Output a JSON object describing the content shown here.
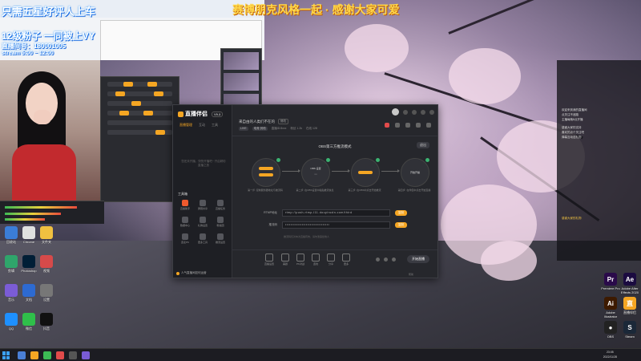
{
  "overlay": {
    "line1": "只需五星好评人上车",
    "line2": "12级粉子 一同被上VY",
    "line3": "直播间号：180001005",
    "line4": "stream 5:00 ~ 12:00",
    "top_banner": "赛博朋克风格一起 · 感谢大家可爱"
  },
  "main_window": {
    "app_name": "直播伴侣",
    "app_badge": "V9.3",
    "tabs": [
      "直播管理",
      "互动",
      "工具"
    ],
    "sidebar_tip": "您还未开播，快快开播吧~ 开启精彩直播之旅",
    "tools_heading": "工具箱",
    "tools": [
      {
        "label": "直播助手",
        "hot": true
      },
      {
        "label": "屏幕共享",
        "hot": false
      },
      {
        "label": "直播任务",
        "hot": false
      },
      {
        "label": "数据中心",
        "hot": false
      },
      {
        "label": "礼物设置",
        "hot": false
      },
      {
        "label": "粉丝团",
        "hot": false
      },
      {
        "label": "连麦PK",
        "hot": false
      },
      {
        "label": "更多工具",
        "hot": false
      },
      {
        "label": "推流设置",
        "hot": false
      }
    ],
    "footer_tip": "人气直播间如何运营",
    "room_title": "来自由的人类们不在的",
    "room_edit": "修改",
    "room_tags": [
      "LIVE",
      "电竞·其他"
    ],
    "room_meta": [
      "直播ID:8xxx",
      "粉丝 1.2k",
      "在线 128"
    ],
    "mode_title": "OBS第三方推流模式",
    "exit_label": "退出",
    "steps": [
      {
        "inner_label": "",
        "caption": "第一步: 复制服务器地址与推流码"
      },
      {
        "inner_label": "OBS 设置",
        "caption": "第二步: 在OBS设置中粘贴推流信息"
      },
      {
        "inner_label": "",
        "caption": "第三步: 在OBS中点击开始推流"
      },
      {
        "inner_label": "开始开播",
        "caption": "第四步: 在伴侣中点击开始直播"
      }
    ],
    "fields": [
      {
        "label": "RTMP地址",
        "value": "rtmp://push-rtmp-l11.douyincdn.com/third",
        "button": "复制"
      },
      {
        "label": "推流码",
        "value": "••••••••••••••••••••••••••••••••",
        "button": "复制"
      }
    ],
    "field_hint": "推流码仅对本次直播有效，请勿泄露给他人",
    "bottom_tools": [
      "直播设置",
      "美颜",
      "PK对战",
      "连线",
      "分享",
      "更多"
    ],
    "go_live_label": "开始直播",
    "bottom_footer": "帮助"
  },
  "right_panel": {
    "lines": [
      "欢迎来到我的直播间",
      "点关注不迷路",
      "主播每晚8点开播",
      "感谢大家的支持",
      "喜欢的点个关注吧",
      "弹幕互动送礼物"
    ],
    "highlight": "感谢大家的礼物"
  },
  "desktop_icons_left": [
    "回收站",
    "Chrome",
    "文件夹",
    "剪辑",
    "Photoshop",
    "视频",
    "音乐",
    "文档",
    "设置",
    "QQ",
    "微信",
    "抖音"
  ],
  "desktop_icons_right": [
    {
      "label": "Premiere Pro",
      "abbr": "Pr",
      "color": "#2a0a4a"
    },
    {
      "label": "Adobe After Effects 2020",
      "abbr": "Ae",
      "color": "#1b0b40"
    },
    {
      "label": "Adobe Illustrator",
      "abbr": "Ai",
      "color": "#3d1a00"
    },
    {
      "label": "直播伴侣",
      "abbr": "直",
      "color": "#f5a623"
    },
    {
      "label": "OBS",
      "abbr": "●",
      "color": "#222"
    },
    {
      "label": "Steam",
      "abbr": "S",
      "color": "#1b2838"
    }
  ],
  "taskbar": {
    "time": "23:05",
    "date": "2022/11/28"
  },
  "colors": {
    "accent": "#f5a623",
    "window_bg": "#26272c",
    "sidebar_bg": "#1e1f24"
  }
}
